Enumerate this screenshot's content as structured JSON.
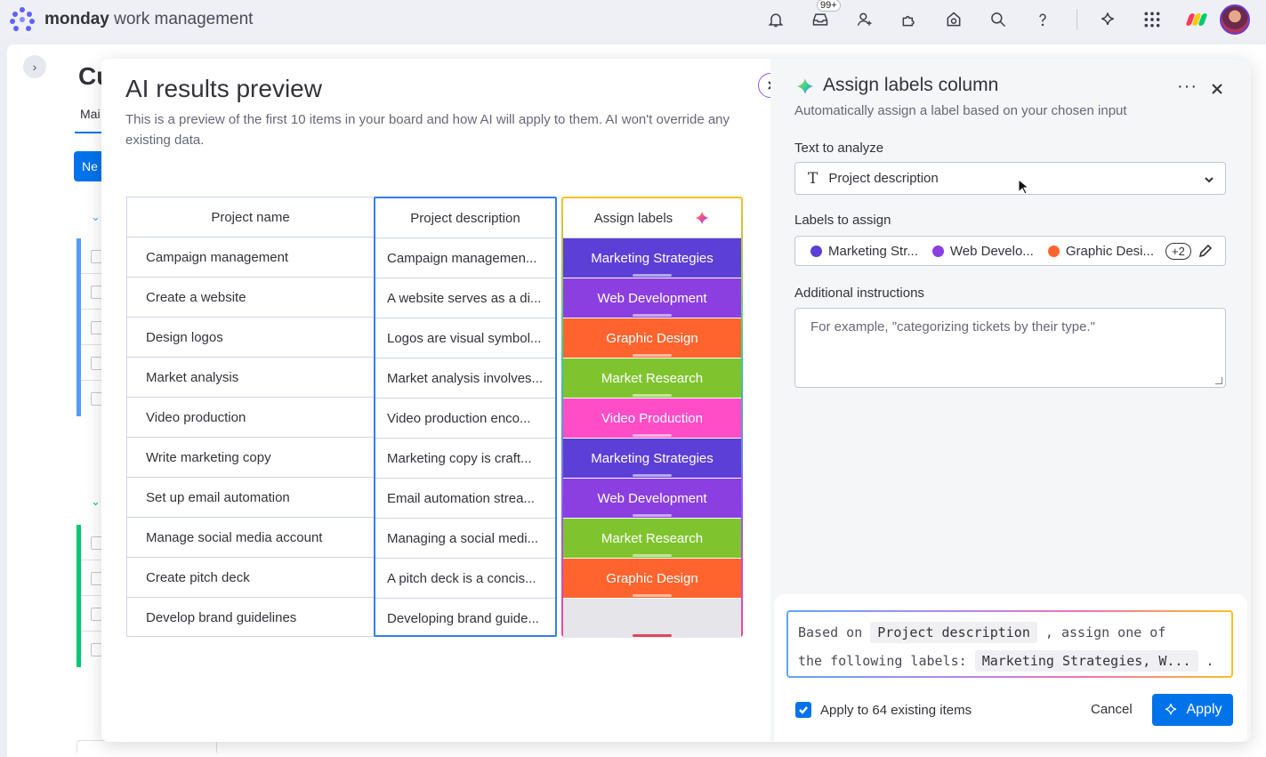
{
  "header": {
    "brand_bold": "monday",
    "brand_rest": "work management",
    "inbox_badge": "99+",
    "icons": [
      "bell-icon",
      "inbox-icon",
      "invite-user-icon",
      "integrations-icon",
      "automations-icon",
      "search-icon",
      "help-icon",
      "ai-sparkle-icon",
      "apps-grid-icon"
    ]
  },
  "background_board": {
    "title_partial": "Cu",
    "tab_partial": "Mai",
    "new_button_partial": "Ne"
  },
  "preview": {
    "title": "AI results preview",
    "description": "This is a preview of the first 10 items in your board and how AI will apply to them. AI won't override any existing data.",
    "columns": [
      "Project name",
      "Project description",
      "Assign labels"
    ],
    "rows": [
      {
        "name": "Campaign management",
        "description": "Campaign managemen...",
        "label": "Marketing Strategies",
        "color": "#5c3fd6"
      },
      {
        "name": "Create a website",
        "description": "A website serves as a di...",
        "label": "Web Development",
        "color": "#8b3fe0"
      },
      {
        "name": "Design logos",
        "description": "Logos are visual symbol...",
        "label": "Graphic Design",
        "color": "#ff642e"
      },
      {
        "name": "Market analysis",
        "description": "Market analysis involves...",
        "label": "Market Research",
        "color": "#7fc42f"
      },
      {
        "name": "Video production",
        "description": "Video production enco...",
        "label": "Video Production",
        "color": "#ff4dc7"
      },
      {
        "name": "Write marketing copy",
        "description": "Marketing copy is craft...",
        "label": "Marketing Strategies",
        "color": "#5c3fd6"
      },
      {
        "name": "Set up email automation",
        "description": "Email automation strea...",
        "label": "Web Development",
        "color": "#8b3fe0"
      },
      {
        "name": "Manage social media account",
        "description": "Managing a social medi...",
        "label": "Market Research",
        "color": "#7fc42f"
      },
      {
        "name": "Create pitch deck",
        "description": "A pitch deck is a concis...",
        "label": "Graphic Design",
        "color": "#ff642e"
      },
      {
        "name": "Develop brand guidelines",
        "description": "Developing brand guide...",
        "label": "",
        "color": ""
      }
    ]
  },
  "panel": {
    "title": "Assign labels column",
    "subtitle": "Automatically assign a label based on your chosen input",
    "text_to_analyze_label": "Text to analyze",
    "text_to_analyze_value": "Project description",
    "labels_to_assign_label": "Labels to assign",
    "labels": [
      {
        "name": "Marketing Str...",
        "color": "#5c3fd6"
      },
      {
        "name": "Web Develo...",
        "color": "#8b3fe0"
      },
      {
        "name": "Graphic Desi...",
        "color": "#ff642e"
      }
    ],
    "more_labels": "+2",
    "additional_instructions_label": "Additional instructions",
    "additional_instructions_placeholder": "For example, \"categorizing tickets by their type.\"",
    "prompt": {
      "prefix": "Based on",
      "source": "Project description",
      "middle": ", assign one of",
      "line2_prefix": "the following labels:",
      "labels": "Marketing Strategies, W...",
      "suffix": "."
    },
    "apply_existing": "Apply to 64 existing items",
    "cancel_label": "Cancel",
    "apply_label": "Apply"
  }
}
